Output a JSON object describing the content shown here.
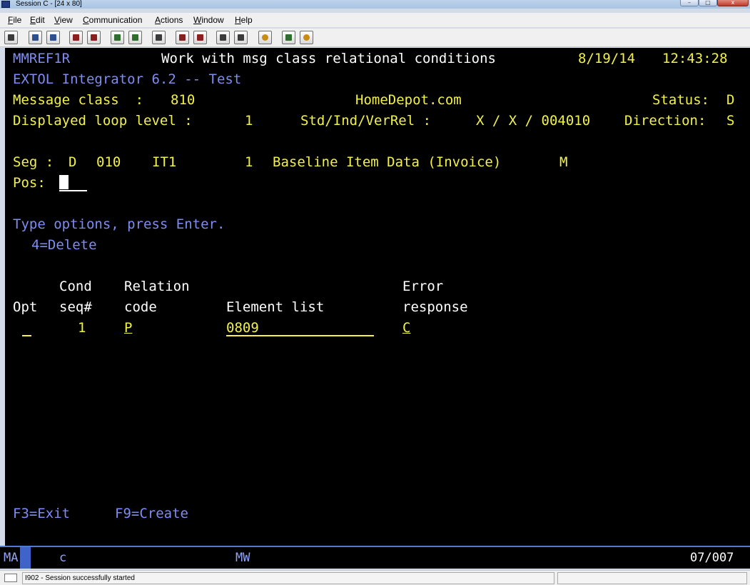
{
  "window": {
    "title": "Session C - [24 x 80]",
    "minimize": "–",
    "maximize": "□",
    "close": "x"
  },
  "menu": [
    "File",
    "Edit",
    "View",
    "Communication",
    "Actions",
    "Window",
    "Help"
  ],
  "toolbar_icons": [
    "print-screen-icon",
    "copy-icon",
    "paste-icon",
    "send-file-icon",
    "receive-file-icon",
    "display-icon",
    "keypad-icon",
    "macro-icon",
    "record-macro-icon",
    "stop-macro-icon",
    "play-macro-icon",
    "clipboard-icon",
    "support-icon",
    "help-icon"
  ],
  "screen": {
    "program": "MMREF1R",
    "title": "Work with msg class relational conditions",
    "date": "8/19/14",
    "time": "12:43:28",
    "product": "EXTOL Integrator 6.2 -- Test",
    "message_class_label": "Message class  :",
    "message_class_value": "810",
    "partner": "HomeDepot.com",
    "status_label": "Status:",
    "status_value": "D",
    "loop_label": "Displayed loop level :",
    "loop_value": "1",
    "std_label": "Std/Ind/VerRel :",
    "std_value": "X / X / 004010",
    "direction_label": "Direction:",
    "direction_value": "S",
    "seg_label": "Seg :",
    "seg_type": "D",
    "seg_num": "010",
    "seg_id": "IT1",
    "seg_count": "1",
    "seg_desc": "Baseline Item Data (Invoice)",
    "seg_req": "M",
    "pos_label": "Pos:",
    "instructions": "Type options, press Enter.",
    "option_delete": "4=Delete",
    "columns": {
      "cond_top": "Cond",
      "relation_top": "Relation",
      "error_top": "Error",
      "opt": "Opt",
      "cond_bottom": "seq#",
      "relation_bottom": "code",
      "element_list": "Element list",
      "error_bottom": "response"
    },
    "rows": [
      {
        "opt": "",
        "seq": "1",
        "relation": "P",
        "elements": "0809",
        "error": "C"
      }
    ],
    "fkeys": {
      "exit": "F3=Exit",
      "create": "F9=Create"
    }
  },
  "oia": {
    "ma": "MA",
    "c": "c",
    "mw": "MW",
    "cursor_pos": "07/007"
  },
  "status": {
    "message": "I902 - Session successfully started"
  }
}
